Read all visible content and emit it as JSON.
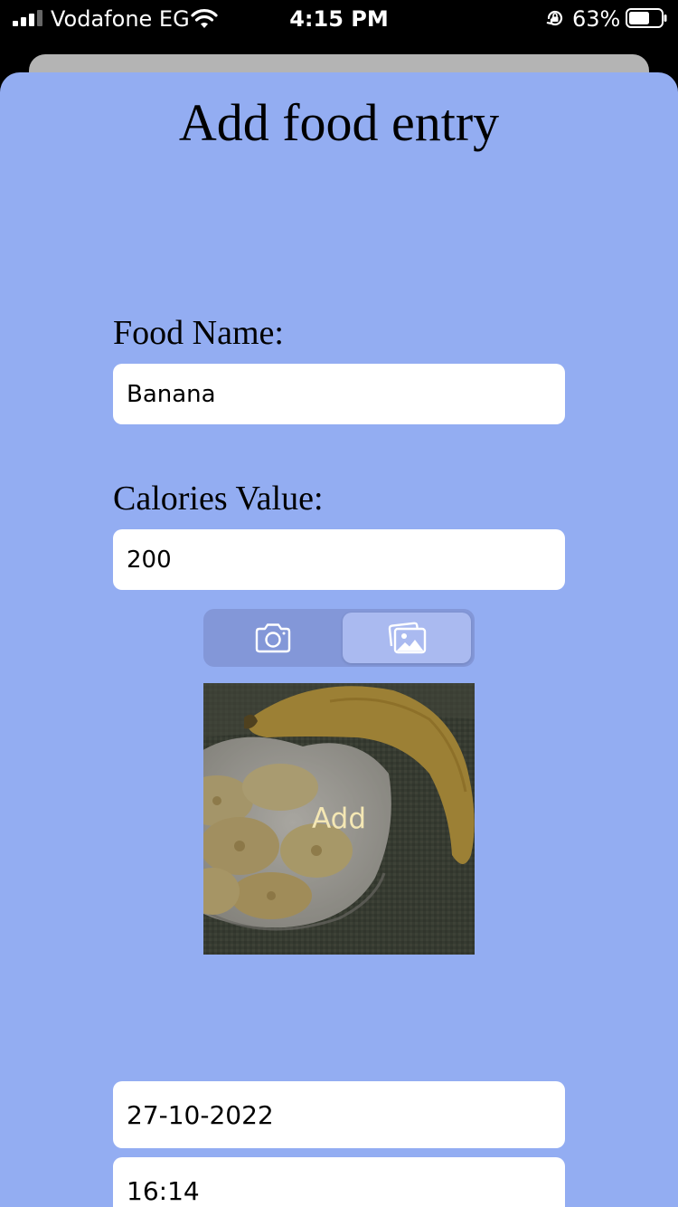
{
  "status_bar": {
    "carrier": "Vodafone EG",
    "time": "4:15 PM",
    "battery_percent": "63%"
  },
  "page": {
    "title": "Add food entry"
  },
  "form": {
    "food_name_label": "Food Name:",
    "food_name_value": "Banana",
    "calories_label": "Calories Value:",
    "calories_value": "200",
    "date_value": "27-10-2022",
    "time_value": "16:14"
  },
  "image_source": {
    "options": [
      "camera-icon",
      "photo-library-icon"
    ],
    "selected": "photo-library-icon"
  },
  "photo": {
    "overlay_label": "Add"
  },
  "colors": {
    "sheet_background": "#93adf2",
    "segmented_background": "#8397d8",
    "segment_selected": "#aabaf0",
    "back_sheet": "#b4b4b4"
  }
}
